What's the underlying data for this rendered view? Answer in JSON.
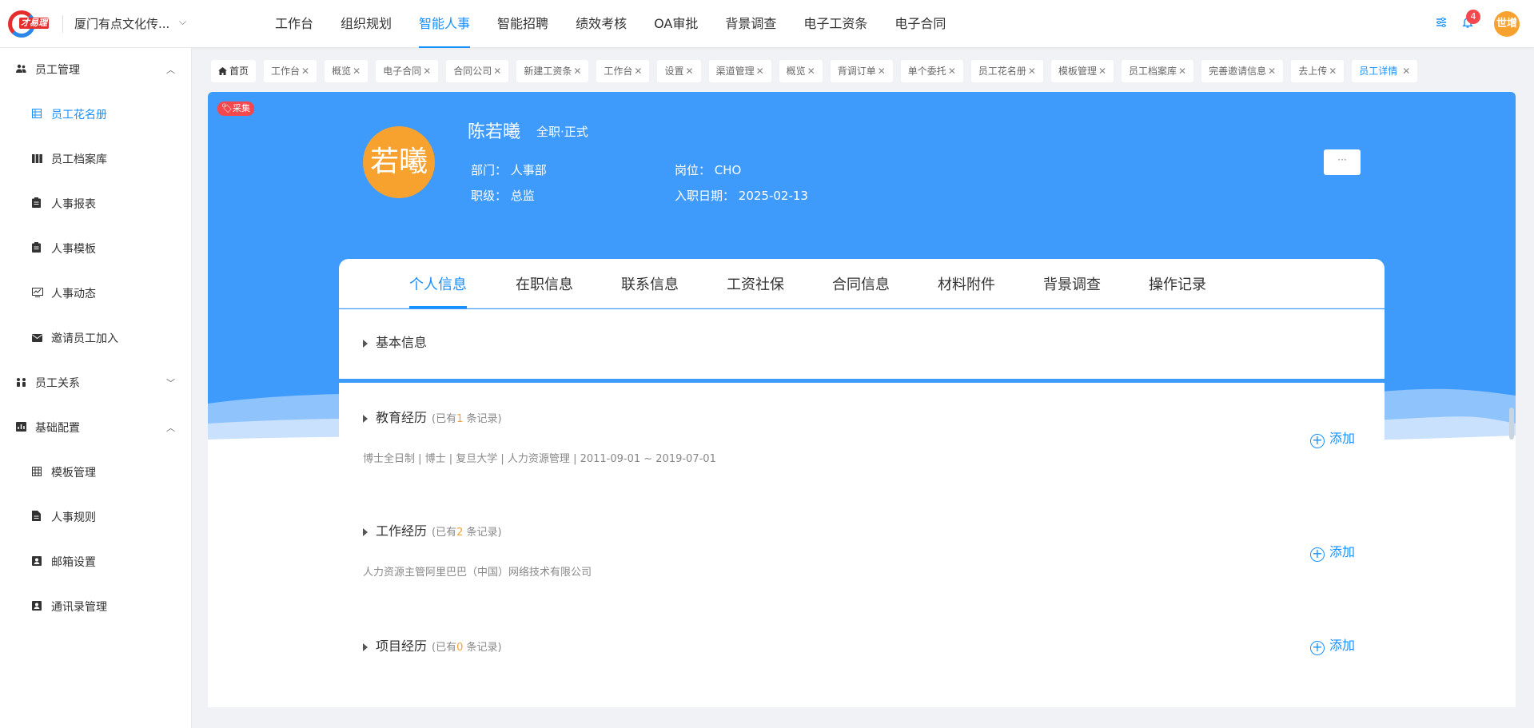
{
  "header": {
    "logo_text": "才易理",
    "company": "厦门有点文化传...",
    "nav": [
      {
        "label": "工作台",
        "active": false
      },
      {
        "label": "组织规划",
        "active": false
      },
      {
        "label": "智能人事",
        "active": true
      },
      {
        "label": "智能招聘",
        "active": false
      },
      {
        "label": "绩效考核",
        "active": false
      },
      {
        "label": "OA审批",
        "active": false
      },
      {
        "label": "背景调查",
        "active": false
      },
      {
        "label": "电子工资条",
        "active": false
      },
      {
        "label": "电子合同",
        "active": false
      }
    ],
    "notification_count": "4",
    "user_avatar": "世增"
  },
  "sidebar": {
    "groups": [
      {
        "label": "员工管理",
        "icon": "users-icon",
        "expanded": true,
        "items": [
          {
            "label": "员工花名册",
            "icon": "table-icon",
            "active": true
          },
          {
            "label": "员工档案库",
            "icon": "archive-icon",
            "active": false
          },
          {
            "label": "人事报表",
            "icon": "clipboard-icon",
            "active": false
          },
          {
            "label": "人事模板",
            "icon": "clipboard-icon",
            "active": false
          },
          {
            "label": "人事动态",
            "icon": "chart-icon",
            "active": false
          },
          {
            "label": "邀请员工加入",
            "icon": "mail-icon",
            "active": false
          }
        ]
      },
      {
        "label": "员工关系",
        "icon": "relation-icon",
        "expanded": false,
        "items": []
      },
      {
        "label": "基础配置",
        "icon": "settings-chart-icon",
        "expanded": true,
        "items": [
          {
            "label": "模板管理",
            "icon": "grid-icon",
            "active": false
          },
          {
            "label": "人事规则",
            "icon": "doc-icon",
            "active": false
          },
          {
            "label": "邮箱设置",
            "icon": "contact-icon",
            "active": false
          },
          {
            "label": "通讯录管理",
            "icon": "contact-icon",
            "active": false
          }
        ]
      }
    ]
  },
  "tabs": [
    {
      "label": "首页",
      "home": true,
      "active": false
    },
    {
      "label": "工作台",
      "active": false
    },
    {
      "label": "概览",
      "active": false
    },
    {
      "label": "电子合同",
      "active": false
    },
    {
      "label": "合同公司",
      "active": false
    },
    {
      "label": "新建工资条",
      "active": false
    },
    {
      "label": "工作台",
      "active": false
    },
    {
      "label": "设置",
      "active": false
    },
    {
      "label": "渠道管理",
      "active": false
    },
    {
      "label": "概览",
      "active": false
    },
    {
      "label": "背调订单",
      "active": false
    },
    {
      "label": "单个委托",
      "active": false
    },
    {
      "label": "员工花名册",
      "active": false
    },
    {
      "label": "模板管理",
      "active": false
    },
    {
      "label": "员工档案库",
      "active": false
    },
    {
      "label": "完善邀请信息",
      "active": false
    },
    {
      "label": "去上传",
      "active": false
    },
    {
      "label": "员工详情",
      "active": true
    }
  ],
  "employee": {
    "collect_tag": "采集",
    "avatar_text": "若曦",
    "name": "陈若曦",
    "type": "全职·正式",
    "dept_label": "部门：",
    "dept": "人事部",
    "position_label": "岗位：",
    "position": "CHO",
    "level_label": "职级：",
    "level": "总监",
    "join_label": "入职日期：",
    "join_date": "2025-02-13",
    "more_label": "···"
  },
  "detail_tabs": [
    "个人信息",
    "在职信息",
    "联系信息",
    "工资社保",
    "合同信息",
    "材料附件",
    "背景调查",
    "操作记录"
  ],
  "sections": {
    "basic": {
      "title": "基本信息"
    },
    "education": {
      "title": "教育经历",
      "count_prefix": "(已有",
      "count": "1",
      "count_suffix": " 条记录)",
      "detail": "博士全日制  |  博士  |  复旦大学  |  人力资源管理  |  2011-09-01 ~ 2019-07-01",
      "add_label": "添加"
    },
    "work": {
      "title": "工作经历",
      "count_prefix": "(已有",
      "count": "2",
      "count_suffix": " 条记录)",
      "detail": "人力资源主管阿里巴巴（中国）网络技术有限公司",
      "add_label": "添加"
    },
    "project": {
      "title": "项目经历",
      "count_prefix": "(已有",
      "count": "0",
      "count_suffix": " 条记录)",
      "add_label": "添加"
    }
  },
  "colors": {
    "primary": "#1890ff",
    "banner": "#3f9bfb",
    "avatar": "#f7a22f",
    "badge": "#f5484e"
  }
}
